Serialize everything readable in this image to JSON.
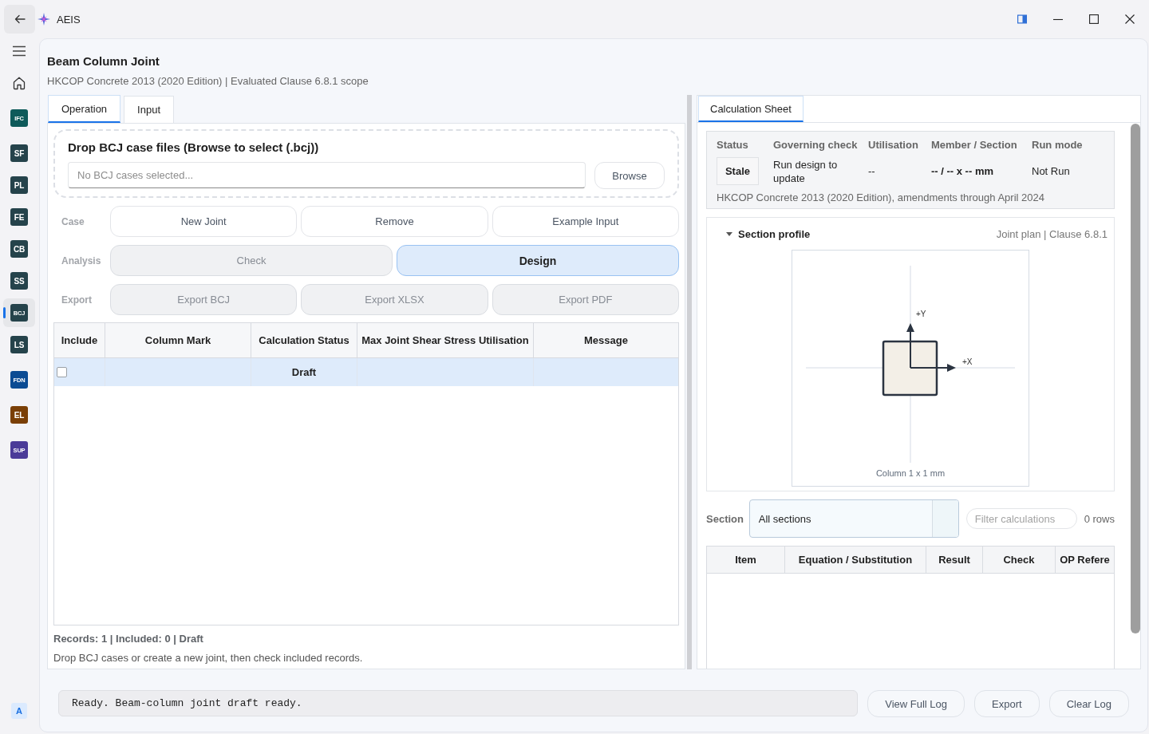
{
  "window": {
    "title": "AEIS"
  },
  "sidebar": {
    "items": [
      {
        "label": "IFC",
        "color": "#0e5a5a",
        "selected": false
      },
      {
        "label": "SF",
        "color": "#25434b",
        "selected": false
      },
      {
        "label": "PL",
        "color": "#25434b",
        "selected": false
      },
      {
        "label": "FE",
        "color": "#25434b",
        "selected": false
      },
      {
        "label": "CB",
        "color": "#25434b",
        "selected": false
      },
      {
        "label": "SS",
        "color": "#25434b",
        "selected": false
      },
      {
        "label": "BCJ",
        "color": "#25434b",
        "selected": true
      },
      {
        "label": "LS",
        "color": "#25434b",
        "selected": false
      },
      {
        "label": "FDN",
        "color": "#0b4b93",
        "selected": false
      },
      {
        "label": "EL",
        "color": "#7a3f06",
        "selected": false
      },
      {
        "label": "SUP",
        "color": "#4b3b98",
        "selected": false
      }
    ],
    "account_badge": "A"
  },
  "page": {
    "title": "Beam Column Joint",
    "subtitle": "HKCOP Concrete 2013 (2020 Edition) | Evaluated Clause 6.8.1 scope"
  },
  "operation_panel": {
    "tabs": [
      {
        "label": "Operation",
        "selected": true
      },
      {
        "label": "Input",
        "selected": false
      }
    ],
    "drop_zone": {
      "title": "Drop BCJ case files (Browse to select (.bcj))",
      "field": {
        "placeholder": "No BCJ cases selected..."
      },
      "browse_button": "Browse"
    },
    "action_groups": [
      {
        "label": "Case",
        "buttons": [
          {
            "label": "New Joint",
            "disabled": false,
            "selected": false
          },
          {
            "label": "Remove",
            "disabled": false,
            "selected": false
          },
          {
            "label": "Example Input",
            "disabled": false,
            "selected": false
          }
        ]
      },
      {
        "label": "Analysis",
        "buttons": [
          {
            "label": "Check",
            "disabled": true,
            "selected": false
          },
          {
            "label": "Design",
            "disabled": false,
            "selected": true
          }
        ]
      },
      {
        "label": "Export",
        "buttons": [
          {
            "label": "Export BCJ",
            "disabled": true,
            "selected": false
          },
          {
            "label": "Export XLSX",
            "disabled": true,
            "selected": false
          },
          {
            "label": "Export PDF",
            "disabled": true,
            "selected": false
          }
        ]
      }
    ],
    "table": {
      "columns": [
        "Include",
        "Column Mark",
        "Calculation Status",
        "Max Joint Shear Stress Utilisation",
        "Message"
      ],
      "rows": [
        {
          "selected": true,
          "checked": false,
          "calculation_status": "Draft"
        }
      ]
    },
    "records_summary": "Records: 1 | Included: 0 | Draft",
    "hint": "Drop BCJ cases or create a new joint, then check included records."
  },
  "calculation_panel": {
    "tabs": [
      {
        "label": "Calculation Sheet",
        "selected": true
      }
    ],
    "summary": {
      "fields": [
        {
          "label": "Status",
          "value": "Stale",
          "kind": "badge"
        },
        {
          "label": "Governing check",
          "value": "Run design to update",
          "kind": "text"
        },
        {
          "label": "Utilisation",
          "value": "--",
          "kind": "text"
        },
        {
          "label": "Member / Section",
          "value": "-- / -- x -- mm",
          "kind": "strong"
        },
        {
          "label": "Run mode",
          "value": "Not Run",
          "kind": "text"
        }
      ],
      "code_note": "HKCOP Concrete 2013 (2020 Edition), amendments through April 2024"
    },
    "section_profile": {
      "title": "Section profile",
      "expanded": true,
      "meta": "Joint plan | Clause 6.8.1",
      "diagram": {
        "y_label": "+Y",
        "x_label": "+X",
        "caption": "Column 1 x 1 mm"
      }
    },
    "filter": {
      "section_label": "Section",
      "section_value": "All sections",
      "search": {
        "placeholder": "Filter calculations"
      },
      "row_count": "0 rows"
    },
    "table": {
      "columns": [
        "Item",
        "Equation / Substitution",
        "Result",
        "Check",
        "OP Refere"
      ]
    }
  },
  "log": {
    "message": "Ready. Beam-column joint draft ready.",
    "buttons": [
      "View Full Log",
      "Export",
      "Clear Log"
    ]
  }
}
